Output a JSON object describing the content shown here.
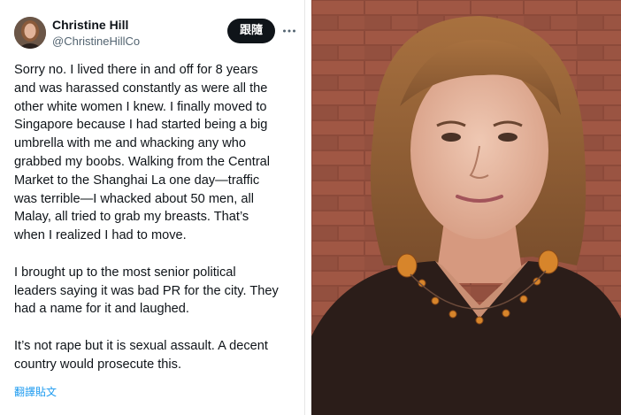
{
  "tweet": {
    "display_name": "Christine Hill",
    "handle": "@ChristineHillCo",
    "follow_label": "跟隨",
    "paragraphs": [
      "Sorry no. I lived there in and off for 8 years\nand was harassed constantly as were all the\nother white women I knew. I finally moved to\nSingapore because I had started being a big\numbrella with me and whacking any who\ngrabbed my boobs. Walking from the Central\nMarket to the Shanghai La one day—traffic\nwas terrible—I whacked about 50 men, all\nMalay, all tried to grab my breasts. That’s\nwhen I realized I had to move.",
      "I brought up to the most senior political\nleaders saying it was bad PR for the city. They\nhad a name for it and laughed.",
      "It’s not rape but it is sexual assault. A decent\ncountry would prosecute this."
    ],
    "translate_label": "翻譯貼文"
  },
  "icons": {
    "more": "more-horizontal-icon"
  },
  "colors": {
    "text": "#0f1419",
    "secondary_text": "#536471",
    "link": "#1d9bf0",
    "follow_button_bg": "#0f1419"
  }
}
